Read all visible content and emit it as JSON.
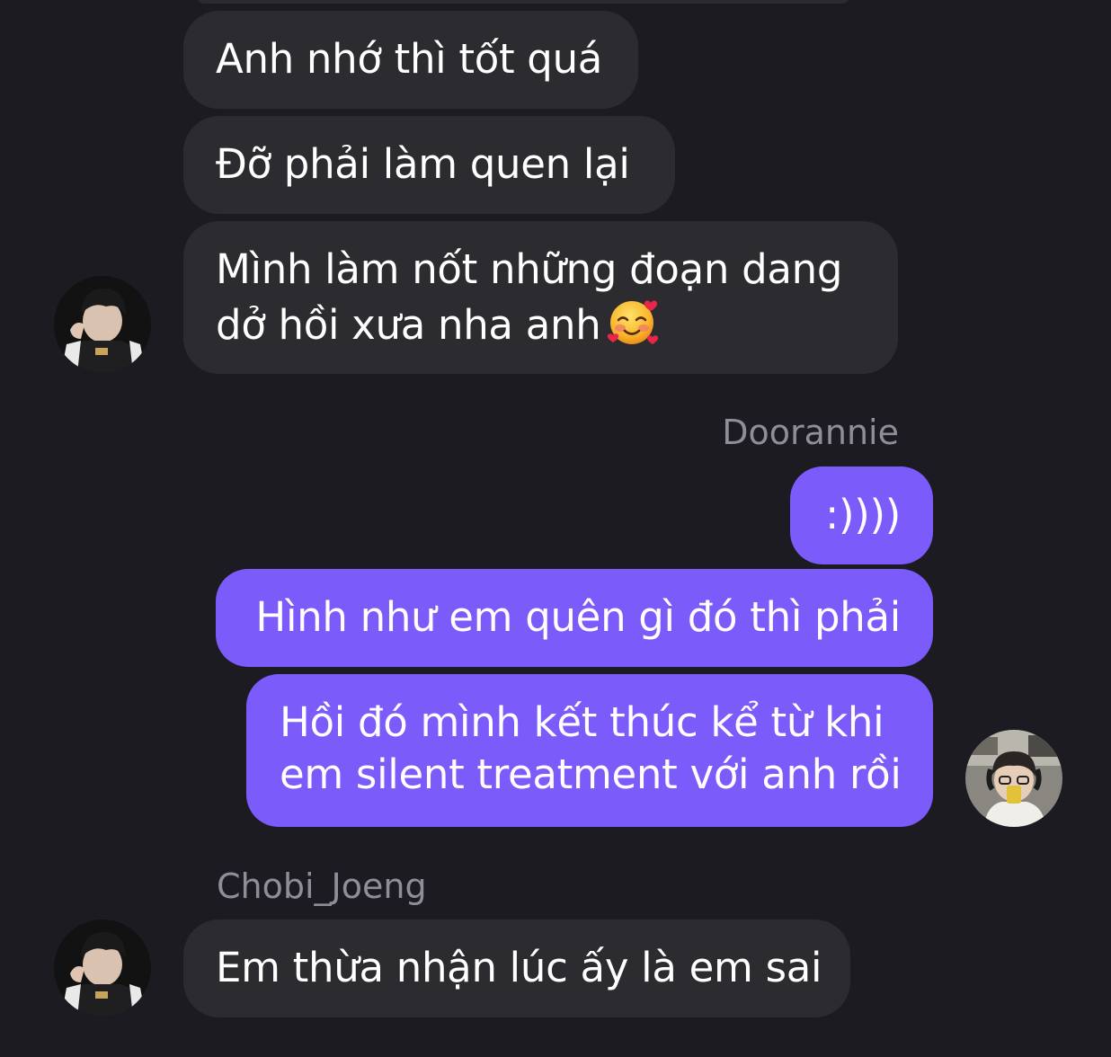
{
  "chat": {
    "messages": [
      {
        "sender": "other",
        "text": "Anh nhớ thì tốt quá"
      },
      {
        "sender": "other",
        "text": "Đỡ phải làm quen lại"
      },
      {
        "sender": "other",
        "lines": [
          "Mình làm nốt những đoạn dang",
          "dở hồi xưa nha anh"
        ],
        "emoji": "smiling-face-with-hearts"
      },
      {
        "sender_name": "Doorannie"
      },
      {
        "sender": "self",
        "text": ":))))"
      },
      {
        "sender": "self",
        "text": "Hình như em quên gì đó thì phải"
      },
      {
        "sender": "self",
        "lines": [
          "Hồi đó mình kết thúc kể từ khi",
          "em silent treatment với anh rồi"
        ]
      },
      {
        "sender_name": "Chobi_Joeng"
      },
      {
        "sender": "other",
        "text": "Em thừa nhận lúc ấy là em sai"
      }
    ]
  },
  "colors": {
    "background": "#1c1b21",
    "incoming_bubble": "#2c2c30",
    "outgoing_bubble": "#7b5bfa",
    "sender_name": "#8f8d96",
    "text": "#ffffff"
  }
}
